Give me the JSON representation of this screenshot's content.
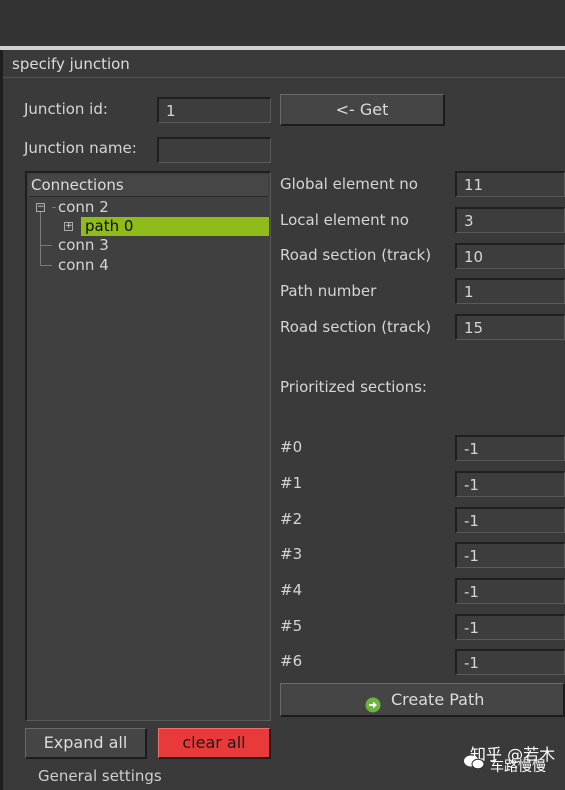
{
  "window": {
    "title": "specify junction"
  },
  "junction": {
    "id_label": "Junction id:",
    "id_value": "1",
    "name_label": "Junction name:",
    "name_value": "",
    "get_button": "<- Get"
  },
  "tree": {
    "header": "Connections",
    "nodes": [
      {
        "label": "conn 2",
        "expander": "−"
      },
      {
        "label": "path 0",
        "expander": "+"
      },
      {
        "label": "conn 3"
      },
      {
        "label": "conn 4"
      }
    ]
  },
  "details": {
    "rows": [
      {
        "label": "Global element no",
        "value": "11"
      },
      {
        "label": "Local element no",
        "value": "3"
      },
      {
        "label": "Road section (track)",
        "value": "10"
      },
      {
        "label": "Path number",
        "value": "1"
      },
      {
        "label": "Road section (track)",
        "value": "15"
      }
    ],
    "prioritized_label": "Prioritized sections:",
    "prioritized": [
      {
        "label": "#0",
        "value": "-1"
      },
      {
        "label": "#1",
        "value": "-1"
      },
      {
        "label": "#2",
        "value": "-1"
      },
      {
        "label": "#3",
        "value": "-1"
      },
      {
        "label": "#4",
        "value": "-1"
      },
      {
        "label": "#5",
        "value": "-1"
      },
      {
        "label": "#6",
        "value": "-1"
      }
    ],
    "create_path_button": "Create Path"
  },
  "buttons": {
    "expand_all": "Expand all",
    "clear_all": "clear all"
  },
  "footer": {
    "general_settings": "General settings"
  },
  "watermark": {
    "line1": "知乎 @若木",
    "line2": "车路慢慢"
  },
  "colors": {
    "selected": "#8fbc1a",
    "clear_all_bg": "#e83a3a",
    "create_icon": "#6db33f"
  },
  "icons": {
    "create_path": "arrow-right-circle-icon"
  }
}
